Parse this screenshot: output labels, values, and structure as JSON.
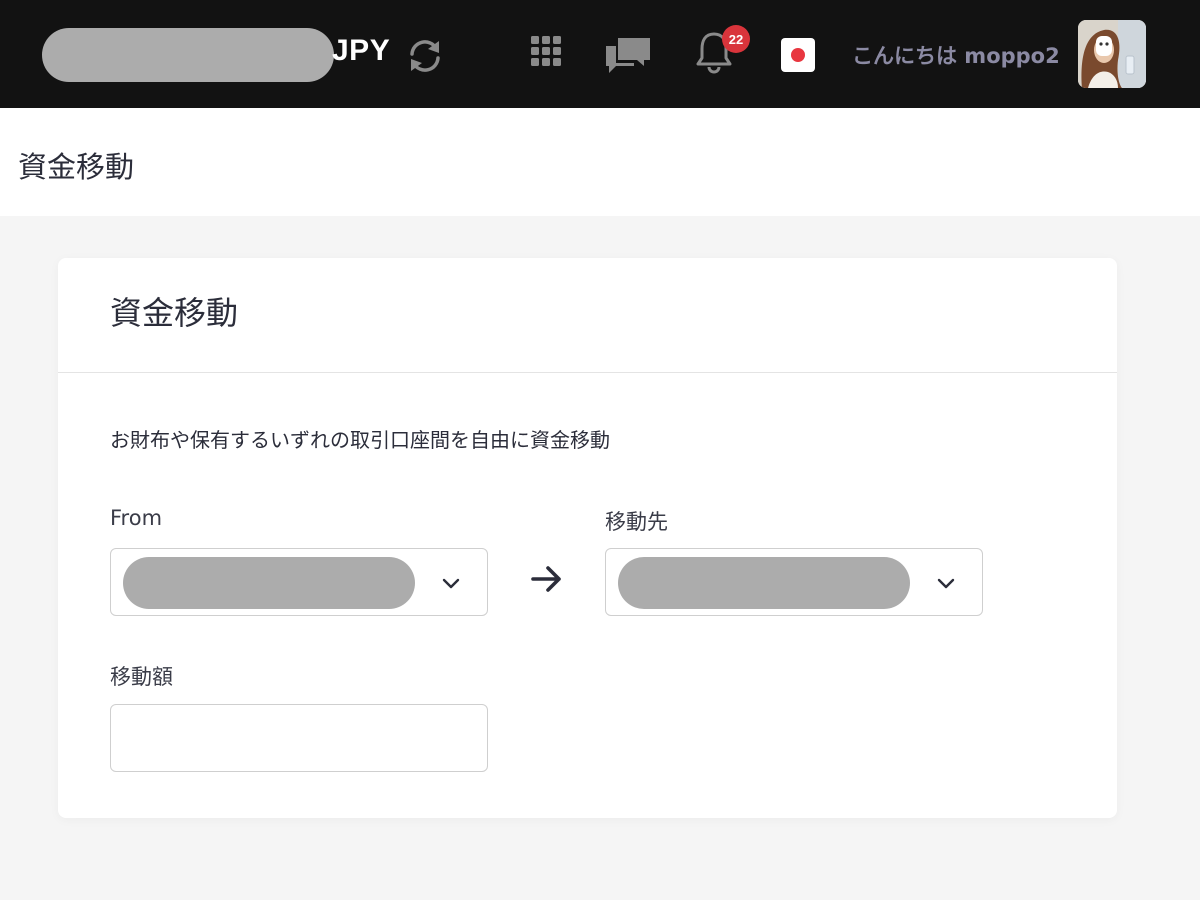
{
  "header": {
    "currency": "JPY",
    "notification_count": "22",
    "greeting": "こんにちは moppo2",
    "accent_badge_color": "#d9343b",
    "icons": [
      "refresh-icon",
      "apps-grid-icon",
      "chat-icon",
      "bell-icon",
      "record-icon",
      "avatar"
    ]
  },
  "page": {
    "title": "資金移動"
  },
  "card": {
    "title": "資金移動",
    "description": "お財布や保有するいずれの取引口座間を自由に資金移動",
    "from_label": "From",
    "to_label": "移動先",
    "amount_label": "移動額",
    "amount_value": ""
  }
}
